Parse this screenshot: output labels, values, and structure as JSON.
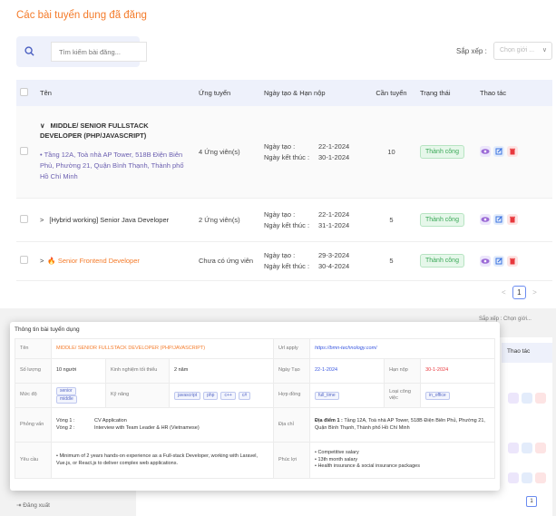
{
  "page": {
    "title": "Các bài tuyển dụng đã đăng"
  },
  "search": {
    "placeholder": "Tìm kiếm bài đăng..."
  },
  "sort": {
    "label": "Sắp xếp :",
    "placeholder": "Chọn giới ..."
  },
  "table": {
    "headers": [
      "Tên",
      "Ứng tuyển",
      "Ngày tạo & Hạn nộp",
      "Cần tuyển",
      "Trạng thái",
      "Thao tác"
    ],
    "rows": [
      {
        "expand": "∨",
        "title": "MIDDLE/ SENIOR FULLSTACK DEVELOPER (PHP/JAVASCRIPT)",
        "address": "Tầng 12A, Toà nhà AP Tower, 518B Điện Biên Phủ, Phường 21, Quận Bình Thạnh, Thành phố Hồ Chí Minh",
        "applicants": "4 Ứng viên(s)",
        "created_label": "Ngày tạo :",
        "created": "22-1-2024",
        "deadline_label": "Ngày kết thúc :",
        "deadline": "30-1-2024",
        "need": "10",
        "status": "Thành công"
      },
      {
        "expand": ">",
        "title": "[Hybrid working] Senior Java Developer",
        "applicants": "2 Ứng viên(s)",
        "created_label": "Ngày tạo :",
        "created": "22-1-2024",
        "deadline_label": "Ngày kết thúc :",
        "deadline": "31-1-2024",
        "need": "5",
        "status": "Thành công"
      },
      {
        "expand": ">",
        "title": "Senior Frontend Developer",
        "applicants": "Chưa có ứng viên",
        "created_label": "Ngày tạo :",
        "created": "29-3-2024",
        "deadline_label": "Ngày kết thúc :",
        "deadline": "30-4-2024",
        "need": "5",
        "status": "Thành công"
      }
    ]
  },
  "pagination": {
    "prev": "<",
    "current": "1",
    "next": ">"
  },
  "background": {
    "sort_label": "Sắp xếp : Chọn giới...",
    "header_action": "Thao tác",
    "logout": "Đăng xuất",
    "page": "1"
  },
  "modal": {
    "title": "Thông tin bài tuyển dụng",
    "name_label": "Tên",
    "name": "MIDDLE/ SENIOR FULLSTACK DEVELOPER (PHP/JAVASCRIPT)",
    "url_label": "Url apply",
    "url": "https://bmn-technology.com/",
    "qty_label": "Số lượng",
    "qty": "10 người",
    "exp_label": "Kinh nghiệm tối thiểu",
    "exp": "2 năm",
    "created_label": "Ngày Tạo",
    "created": "22-1-2024",
    "deadline_label": "Hạn nộp",
    "deadline": "30-1-2024",
    "level_label": "Mức độ",
    "levels": [
      "senior",
      "middle"
    ],
    "skills_label": "Kỹ năng",
    "skills": [
      "javascript",
      "php",
      "c++",
      "c#"
    ],
    "contract_label": "Hợp đồng",
    "contract": "full_time",
    "worktype_label": "Loại công việc",
    "worktype": "in_office",
    "interview_label": "Phỏng vấn",
    "rounds": [
      {
        "round": "Vòng 1 :",
        "desc": "CV Application"
      },
      {
        "round": "Vòng 2 :",
        "desc": "Interview with Team Leader & HR (Vietnamese)"
      }
    ],
    "address_label": "Địa chỉ",
    "address_prefix": "Địa điểm 1 :",
    "address": "Tầng 12A, Toà nhà AP Tower, 518B Điện Biên Phủ, Phường 21, Quận Bình Thạnh, Thành phố Hồ Chí Minh",
    "req_label": "Yêu cầu",
    "requirements": "• Minimum of 2 years hands-on experience as a Full-stack Developer, working with Laravel, Vue.js, or React.js to deliver complex web applications.",
    "benefits_label": "Phúc lợi",
    "benefits": [
      "• Competitive salary",
      "• 13th month salary",
      "• Health insurance & social insurance packages"
    ]
  }
}
